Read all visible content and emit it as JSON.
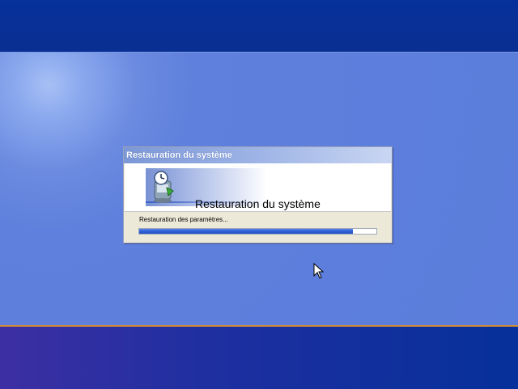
{
  "dialog": {
    "title": "Restauration du système",
    "banner_title": "Restauration du système",
    "status": "Restauration des paramètres...",
    "progress": 0.9,
    "icon": "system-restore-icon"
  },
  "colors": {
    "desktop": "#5f80dc",
    "top_band": "#06309a",
    "progress_fill": "#2d5fd5"
  }
}
